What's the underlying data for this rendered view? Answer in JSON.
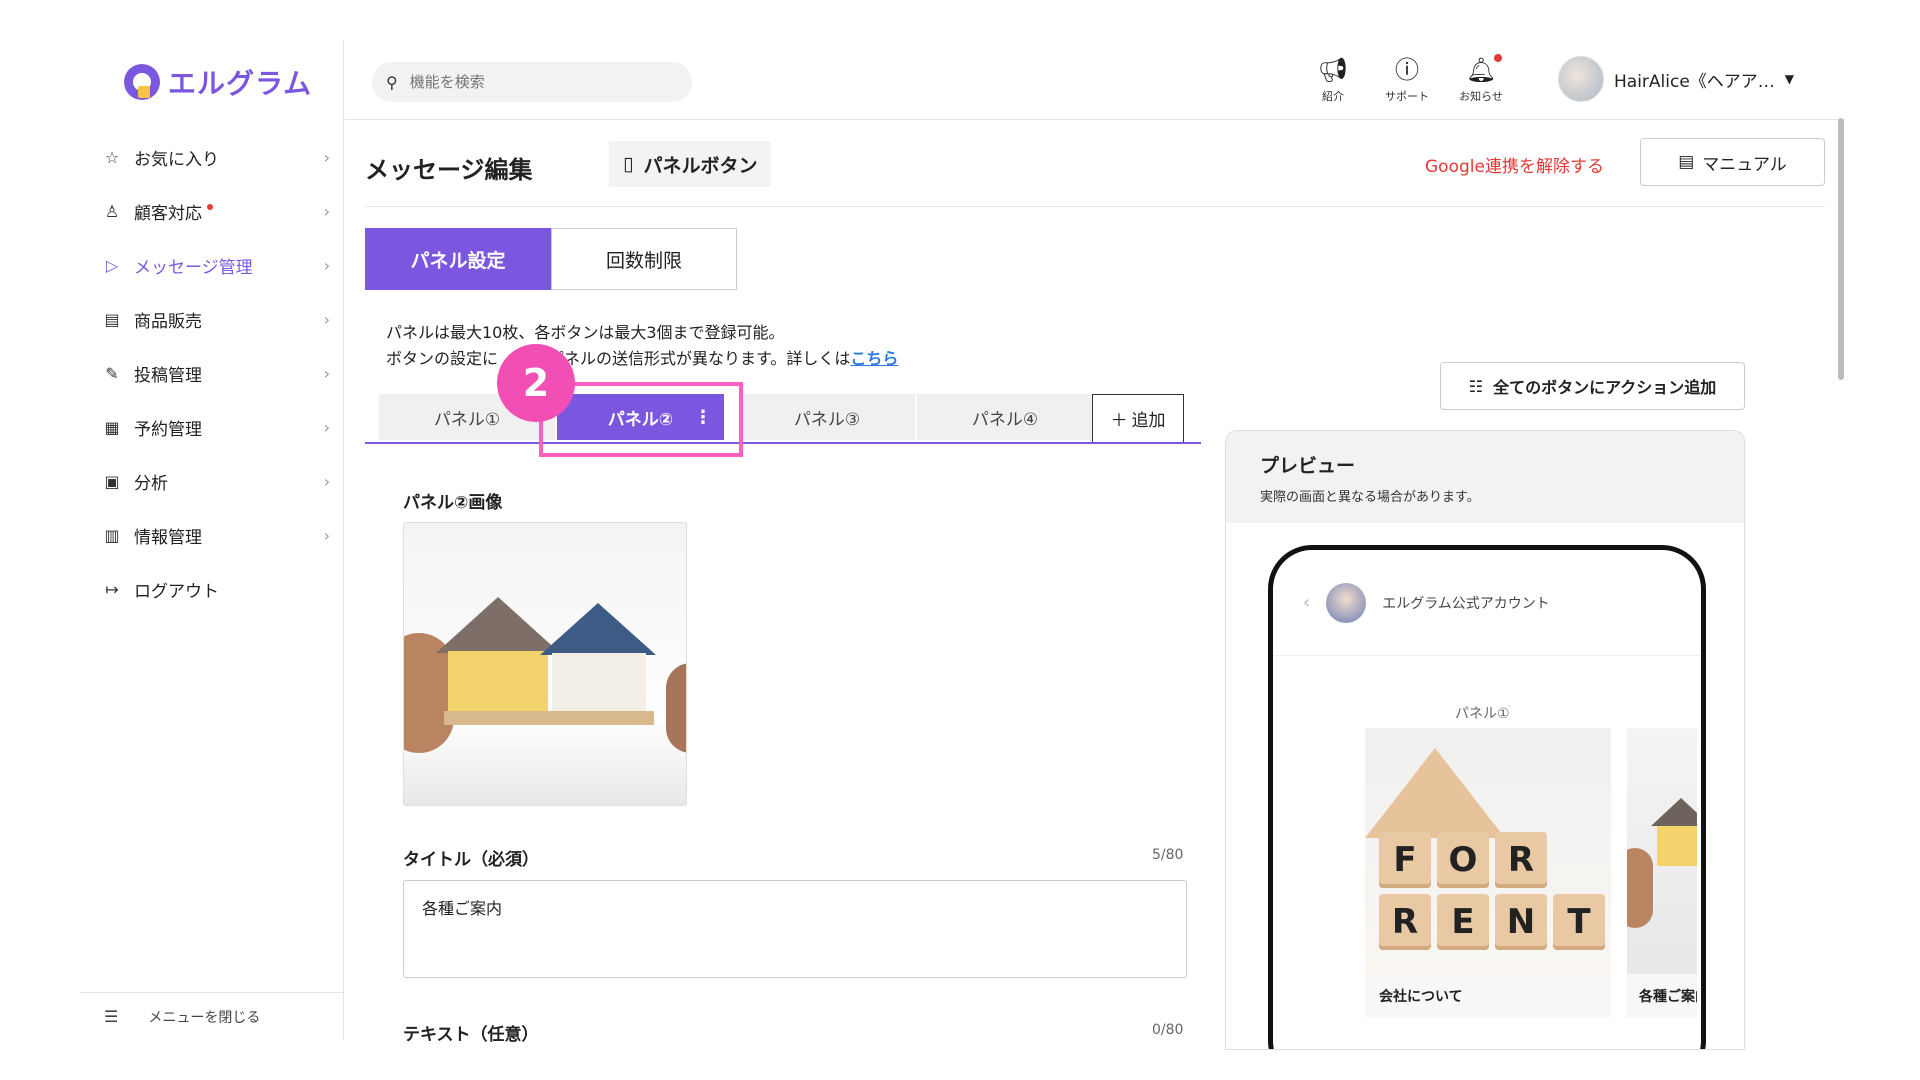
{
  "app": {
    "logo_text": "エルグラム"
  },
  "sidebar": {
    "items": [
      {
        "label": "お気に入り",
        "icon": "star-icon"
      },
      {
        "label": "顧客対応",
        "icon": "user-icon",
        "badge": true
      },
      {
        "label": "メッセージ管理",
        "icon": "send-icon",
        "active": true
      },
      {
        "label": "商品販売",
        "icon": "store-icon"
      },
      {
        "label": "投稿管理",
        "icon": "edit-icon"
      },
      {
        "label": "予約管理",
        "icon": "calendar-icon"
      },
      {
        "label": "分析",
        "icon": "report-icon"
      },
      {
        "label": "情報管理",
        "icon": "bar-chart-icon"
      },
      {
        "label": "ログアウト",
        "icon": "logout-icon"
      }
    ],
    "close_menu": "メニューを閉じる"
  },
  "topbar": {
    "search_placeholder": "機能を検索",
    "icons": [
      {
        "label": "紹介",
        "icon": "megaphone-icon"
      },
      {
        "label": "サポート",
        "icon": "help-icon"
      },
      {
        "label": "お知らせ",
        "icon": "bell-icon"
      }
    ],
    "username": "HairAlice《ヘアア…"
  },
  "header": {
    "title": "メッセージ編集",
    "type_chip": "パネルボタン",
    "google_link": "Google連携を解除する",
    "manual_button": "マニュアル"
  },
  "settings_tabs": [
    "パネル設定",
    "回数制限"
  ],
  "info": {
    "line1": "パネルは最大10枚、各ボタンは最大3個まで登録可能。",
    "line2_prefix": "ボタンの設定に",
    "line2_suffix": "パネルの送信形式が異なります。詳しくは",
    "link": "こちら"
  },
  "panel_tabs": [
    "パネル①",
    "パネル②",
    "パネル③",
    "パネル④"
  ],
  "panel_add": "追加",
  "step_badge": "2",
  "form": {
    "image_label": "パネル②画像",
    "title_label": "タイトル（必須）",
    "title_counter": "5/80",
    "title_value": "各種ご案内",
    "text_label": "テキスト（任意）",
    "text_counter": "0/80"
  },
  "preview": {
    "action_button": "全てのボタンにアクション追加",
    "title": "プレビュー",
    "note": "実際の画面と異なる場合があります。",
    "account_name": "エルグラム公式アカウント",
    "card_label": "パネル①",
    "card1_title": "会社について",
    "card1_blocks": [
      "F",
      "O",
      "R",
      "",
      "R",
      "E",
      "N",
      "T"
    ],
    "card2_title": "各種ご案内"
  },
  "colors": {
    "accent": "#7b57e0",
    "highlight": "#ff5fbf",
    "danger": "#e53935",
    "link": "#2a7ae2"
  }
}
